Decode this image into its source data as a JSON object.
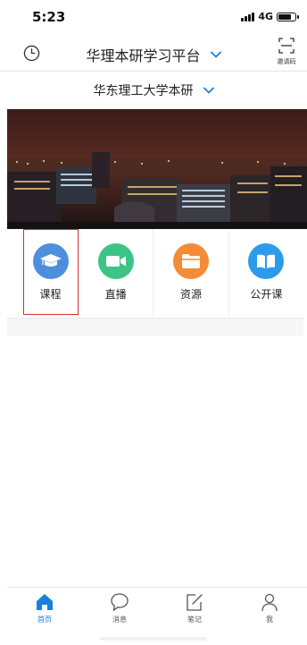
{
  "status_bar": {
    "time": "5:23",
    "network": "4G"
  },
  "header": {
    "title": "华理本研学习平台",
    "scan_label": "邀请码"
  },
  "school": {
    "name": "华东理工大学本研"
  },
  "grid": [
    {
      "label": "课程",
      "color": "#4d8fdc",
      "icon": "graduation-cap-icon"
    },
    {
      "label": "直播",
      "color": "#3cc487",
      "icon": "video-camera-icon"
    },
    {
      "label": "资源",
      "color": "#f48b35",
      "icon": "folder-icon"
    },
    {
      "label": "公开课",
      "color": "#2b9bea",
      "icon": "open-book-icon"
    }
  ],
  "tabbar": [
    {
      "label": "首页",
      "icon": "home-icon",
      "active": true
    },
    {
      "label": "消息",
      "icon": "chat-bubble-icon",
      "active": false
    },
    {
      "label": "笔记",
      "icon": "note-edit-icon",
      "active": false
    },
    {
      "label": "我",
      "icon": "person-icon",
      "active": false
    }
  ],
  "colors": {
    "accent": "#1a7fdc",
    "selection": "#d9302c"
  }
}
